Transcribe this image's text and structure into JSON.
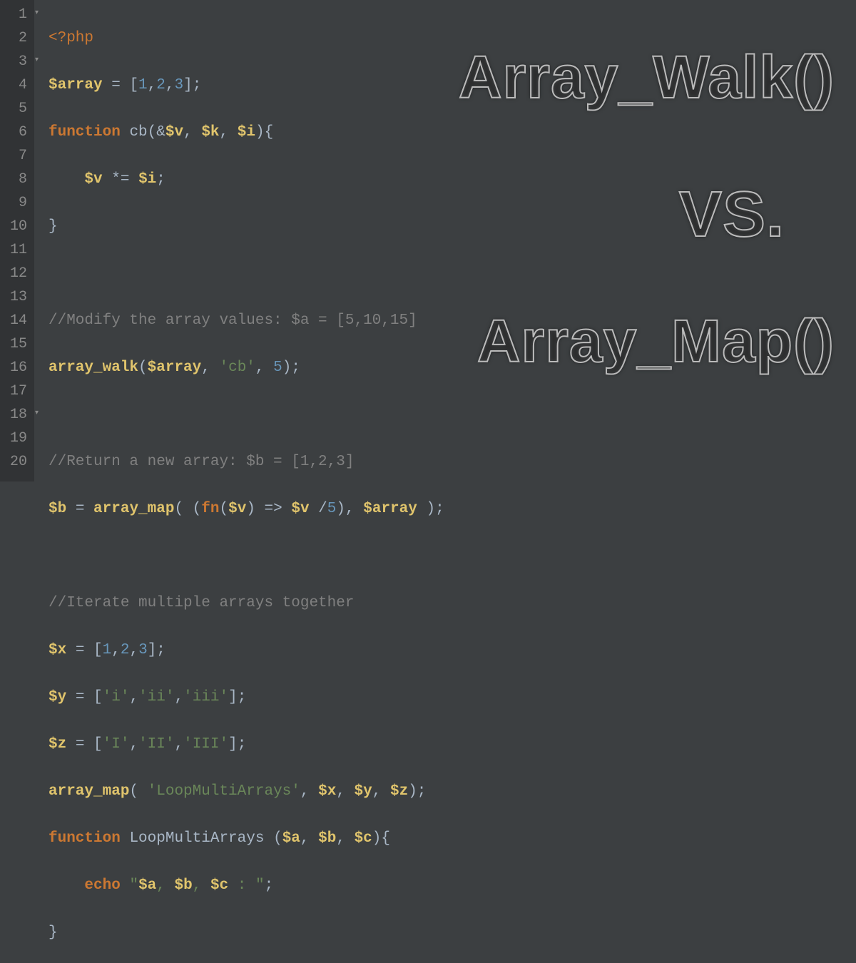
{
  "overlay": {
    "title1": "Array_Walk()",
    "title2": "VS.",
    "title3": "Array_Map()"
  },
  "gutter": {
    "lines": [
      "1",
      "2",
      "3",
      "4",
      "5",
      "6",
      "7",
      "8",
      "9",
      "10",
      "11",
      "12",
      "13",
      "14",
      "15",
      "16",
      "17",
      "18",
      "19",
      "20"
    ]
  },
  "fold": {
    "open_glyph": "▾",
    "close_glyph": "▸"
  },
  "code": {
    "l1": {
      "open": "<?php"
    },
    "l2": {
      "var": "$array",
      "eq": " = ",
      "arr_open": "[",
      "n1": "1",
      "c1": ",",
      "n2": "2",
      "c2": ",",
      "n3": "3",
      "arr_close": "];"
    },
    "l3": {
      "kw": "function",
      "sp": " ",
      "name": "cb",
      "open": "(",
      "amp": "&",
      "v1": "$v",
      "c1": ", ",
      "v2": "$k",
      "c2": ", ",
      "v3": "$i",
      "close": "){"
    },
    "l4": {
      "indent": "    ",
      "v": "$v",
      "op": " *= ",
      "i": "$i",
      "semi": ";"
    },
    "l5": {
      "brace": "}"
    },
    "l6": {
      "blank": ""
    },
    "l7": {
      "comment": "//Modify the array values: $a = [5,10,15]"
    },
    "l8": {
      "fn": "array_walk",
      "open": "(",
      "v": "$array",
      "c1": ", ",
      "s": "'cb'",
      "c2": ", ",
      "n": "5",
      "close": ");"
    },
    "l9": {
      "blank": ""
    },
    "l10": {
      "comment": "//Return a new array: $b = [1,2,3]"
    },
    "l11": {
      "v": "$b",
      "eq": " = ",
      "fn": "array_map",
      "open": "( ",
      "popen": "(",
      "kw": "fn",
      "popen2": "(",
      "pv": "$v",
      "pclose": ")",
      "arrow": " => ",
      "pv2": "$v",
      "div": " /",
      "n": "5",
      "pclose2": ")",
      "c": ", ",
      "arr": "$array",
      "close": " );"
    },
    "l12": {
      "blank": ""
    },
    "l13": {
      "comment": "//Iterate multiple arrays together"
    },
    "l14": {
      "v": "$x",
      "eq": " = ",
      "open": "[",
      "n1": "1",
      "c1": ",",
      "n2": "2",
      "c2": ",",
      "n3": "3",
      "close": "];"
    },
    "l15": {
      "v": "$y",
      "eq": " = ",
      "open": "[",
      "s1": "'i'",
      "c1": ",",
      "s2": "'ii'",
      "c2": ",",
      "s3": "'iii'",
      "close": "];"
    },
    "l16": {
      "v": "$z",
      "eq": " = ",
      "open": "[",
      "s1": "'I'",
      "c1": ",",
      "s2": "'II'",
      "c2": ",",
      "s3": "'III'",
      "close": "];"
    },
    "l17": {
      "fn": "array_map",
      "open": "( ",
      "s": "'LoopMultiArrays'",
      "c1": ", ",
      "v1": "$x",
      "c2": ", ",
      "v2": "$y",
      "c3": ", ",
      "v3": "$z",
      "close": ");"
    },
    "l18": {
      "kw": "function",
      "sp": " ",
      "name": "LoopMultiArrays",
      "sp2": " ",
      "open": "(",
      "v1": "$a",
      "c1": ", ",
      "v2": "$b",
      "c2": ", ",
      "v3": "$c",
      "close": "){"
    },
    "l19": {
      "indent": "    ",
      "kw": "echo",
      "sp": " ",
      "q1": "\"",
      "v1": "$a",
      "t1": ", ",
      "v2": "$b",
      "t2": ", ",
      "v3": "$c",
      "t3": " : ",
      "q2": "\"",
      "semi": ";"
    },
    "l20": {
      "brace": "}"
    }
  }
}
